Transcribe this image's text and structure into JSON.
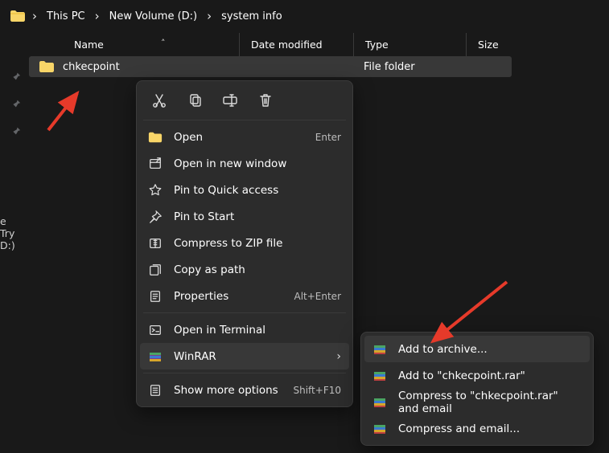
{
  "breadcrumb": {
    "items": [
      "This PC",
      "New Volume (D:)",
      "system info"
    ]
  },
  "columns": {
    "name": "Name",
    "date": "Date modified",
    "type": "Type",
    "size": "Size"
  },
  "rows": [
    {
      "name": "chkecpoint",
      "date": "",
      "type": "File folder",
      "size": ""
    }
  ],
  "gutter": {
    "item1": "e Try",
    "item2": "D:)"
  },
  "ctx": {
    "open": {
      "label": "Open",
      "shortcut": "Enter"
    },
    "newwin": {
      "label": "Open in new window"
    },
    "pinquick": {
      "label": "Pin to Quick access"
    },
    "pinstart": {
      "label": "Pin to Start"
    },
    "zip": {
      "label": "Compress to ZIP file"
    },
    "copyaspath": {
      "label": "Copy as path"
    },
    "properties": {
      "label": "Properties",
      "shortcut": "Alt+Enter"
    },
    "terminal": {
      "label": "Open in Terminal"
    },
    "winrar": {
      "label": "WinRAR"
    },
    "showmore": {
      "label": "Show more options",
      "shortcut": "Shift+F10"
    }
  },
  "submenu": {
    "addarchive": {
      "label": "Add to archive..."
    },
    "addnamer": {
      "label": "Add to \"chkecpoint.rar\""
    },
    "compemail": {
      "label": "Compress to \"chkecpoint.rar\" and email"
    },
    "compemail2": {
      "label": "Compress and email..."
    }
  }
}
